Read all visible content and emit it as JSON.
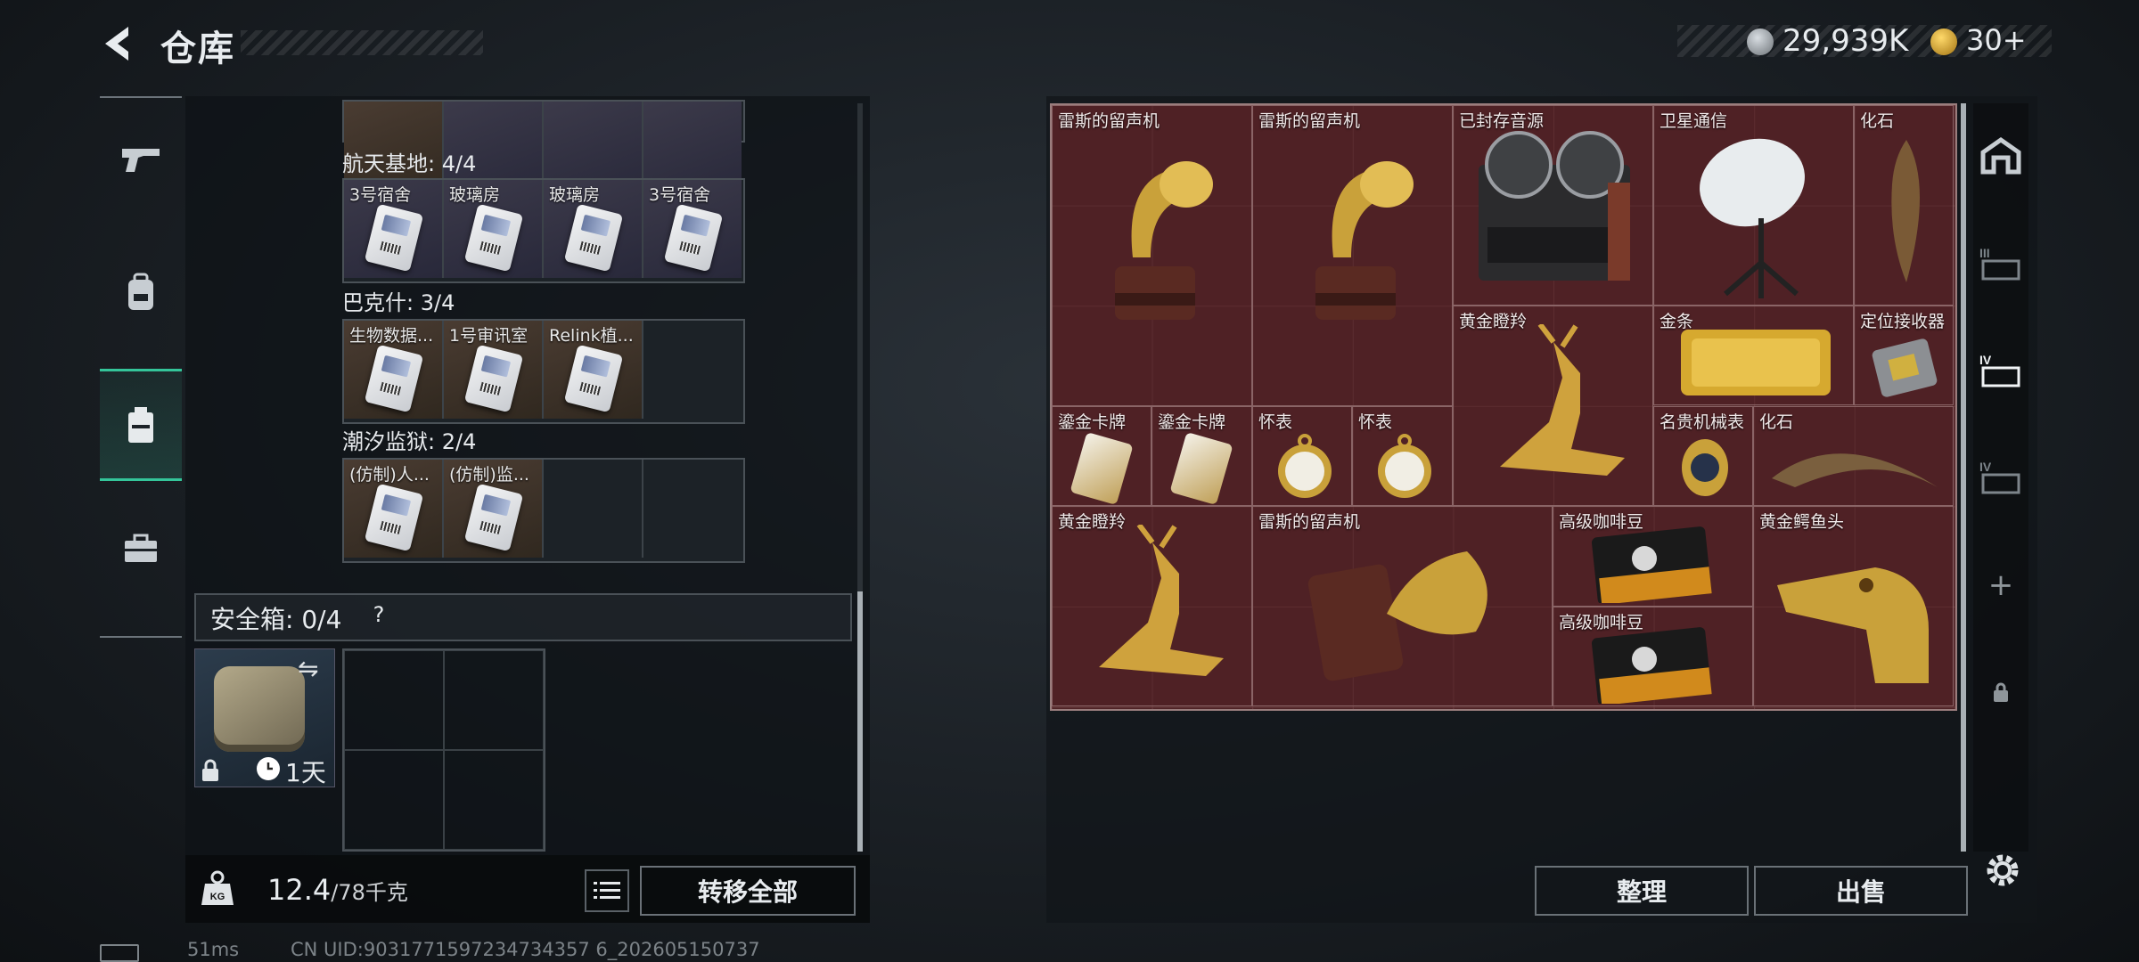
{
  "header": {
    "title": "仓库"
  },
  "currency": {
    "silver": "29,939K",
    "gold": "30+"
  },
  "left": {
    "sections": [
      {
        "title": "航天基地: 4/4",
        "items": [
          "3号宿舍",
          "玻璃房",
          "玻璃房",
          "3号宿舍"
        ]
      },
      {
        "title": "巴克什: 3/4",
        "items": [
          "生物数据...",
          "1号审讯室",
          "Relink植..."
        ]
      },
      {
        "title": "潮汐监狱: 2/4",
        "items": [
          "(仿制)人...",
          "(仿制)监..."
        ]
      }
    ],
    "safe": {
      "label": "安全箱: 0/4",
      "help": "?",
      "days": "1天"
    },
    "weight": {
      "value": "12.4",
      "max": "/78千克"
    },
    "transfer_label": "转移全部"
  },
  "status": {
    "ping": "51ms",
    "uid": "CN UID:9031771597234734357 6_202605150737"
  },
  "storage": {
    "items": [
      {
        "label": "雷斯的留声机"
      },
      {
        "label": "雷斯的留声机"
      },
      {
        "label": "已封存音源"
      },
      {
        "label": "卫星通信"
      },
      {
        "label": "化石"
      },
      {
        "label": "黄金瞪羚"
      },
      {
        "label": "金条"
      },
      {
        "label": "定位接收器"
      },
      {
        "label": "鎏金卡牌"
      },
      {
        "label": "鎏金卡牌"
      },
      {
        "label": "怀表"
      },
      {
        "label": "怀表"
      },
      {
        "label": "名贵机械表"
      },
      {
        "label": "化石"
      },
      {
        "label": "黄金瞪羚"
      },
      {
        "label": "雷斯的留声机"
      },
      {
        "label": "高级咖啡豆"
      },
      {
        "label": "高级咖啡豆"
      },
      {
        "label": "黄金鳄鱼头"
      }
    ],
    "sort_label": "整理",
    "sell_label": "出售"
  },
  "right_rail": {
    "plus": "+"
  }
}
